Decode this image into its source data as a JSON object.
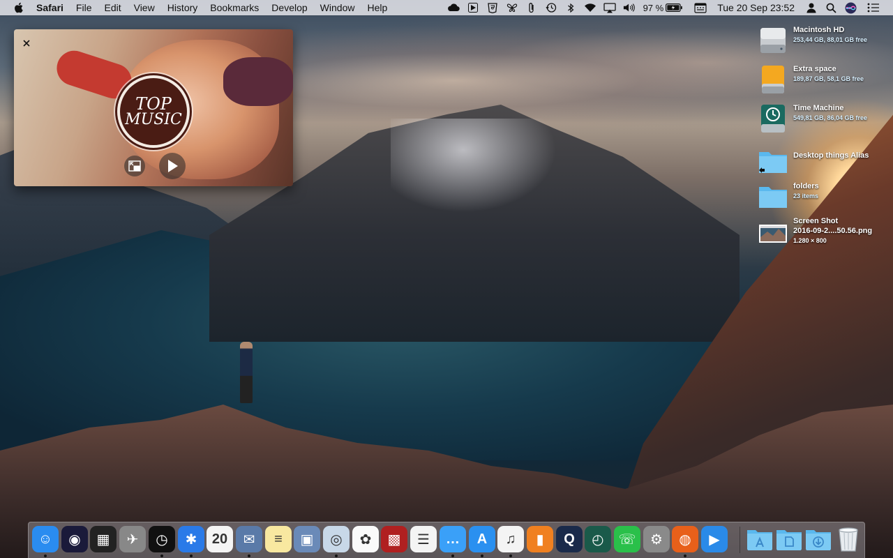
{
  "menubar": {
    "app_name": "Safari",
    "menus": [
      "File",
      "Edit",
      "View",
      "History",
      "Bookmarks",
      "Develop",
      "Window",
      "Help"
    ],
    "status_icons": [
      "cloud-icon",
      "play-triangle-icon",
      "html5-icon",
      "butterfly-icon",
      "paperclip-icon",
      "time-machine-icon",
      "bluetooth-icon",
      "wifi-icon",
      "airplay-icon",
      "volume-icon"
    ],
    "battery_percent": "97 %",
    "datetime": "Tue 20 Sep  23:52"
  },
  "pip": {
    "badge_line1": "TOP",
    "badge_line2": "MUSIC",
    "accent": "#4a1c14"
  },
  "desktop": {
    "items": [
      {
        "name": "Macintosh HD",
        "info": "253,44 GB, 88,01 GB free",
        "icon": "hard-drive-icon"
      },
      {
        "name": "Extra space",
        "info": "189,87 GB, 58,1 GB free",
        "icon": "external-drive-icon"
      },
      {
        "name": "Time Machine",
        "info": "549,81 GB, 86,04 GB free",
        "icon": "time-machine-drive-icon"
      },
      {
        "name": "Desktop things Alias",
        "info": "",
        "icon": "folder-alias-icon"
      },
      {
        "name": "folders",
        "info": "23 items",
        "icon": "folder-icon"
      },
      {
        "name": "Screen Shot",
        "name2": "2016-09-2....50.56.png",
        "info": "1.280 × 800",
        "icon": "screenshot-thumbnail-icon"
      }
    ]
  },
  "dock": {
    "apps": [
      {
        "name": "finder",
        "color": "#2a8cf0",
        "glyph": "☺",
        "running": true
      },
      {
        "name": "siri",
        "color": "#1a1a3a",
        "glyph": "◉",
        "running": false
      },
      {
        "name": "mission-control",
        "color": "#222",
        "glyph": "▦",
        "running": false
      },
      {
        "name": "launchpad",
        "color": "#888",
        "glyph": "✈",
        "running": false
      },
      {
        "name": "dashboard",
        "color": "#111",
        "glyph": "◷",
        "running": true
      },
      {
        "name": "safari",
        "color": "#2a7ae8",
        "glyph": "✱",
        "running": true
      },
      {
        "name": "calendar",
        "color": "#f4f4f4",
        "glyph": "20",
        "running": false
      },
      {
        "name": "mail",
        "color": "#5a7aa8",
        "glyph": "✉",
        "running": true
      },
      {
        "name": "notes",
        "color": "#f8e8a0",
        "glyph": "≡",
        "running": false
      },
      {
        "name": "preview",
        "color": "#6a8ab8",
        "glyph": "▣",
        "running": false
      },
      {
        "name": "image-capture",
        "color": "#c8d8e8",
        "glyph": "◎",
        "running": true
      },
      {
        "name": "photos",
        "color": "#fafafa",
        "glyph": "✿",
        "running": false
      },
      {
        "name": "photo-booth",
        "color": "#b02020",
        "glyph": "▩",
        "running": false
      },
      {
        "name": "reminders",
        "color": "#f4f4f4",
        "glyph": "☰",
        "running": false
      },
      {
        "name": "messages",
        "color": "#3aa0f8",
        "glyph": "…",
        "running": true
      },
      {
        "name": "app-store",
        "color": "#2a90f0",
        "glyph": "A",
        "running": true
      },
      {
        "name": "itunes",
        "color": "#f4f4f4",
        "glyph": "♫",
        "running": true
      },
      {
        "name": "ibooks",
        "color": "#f08020",
        "glyph": "▮",
        "running": false
      },
      {
        "name": "quicktime",
        "color": "#1a2a4a",
        "glyph": "Q",
        "running": false
      },
      {
        "name": "time-machine",
        "color": "#1a5a4a",
        "glyph": "◴",
        "running": false
      },
      {
        "name": "facetime",
        "color": "#2ac04a",
        "glyph": "☏",
        "running": false
      },
      {
        "name": "system-preferences",
        "color": "#8a8a8a",
        "glyph": "⚙",
        "running": false
      },
      {
        "name": "firefox",
        "color": "#e8601a",
        "glyph": "◍",
        "running": true
      },
      {
        "name": "quicktime-player",
        "color": "#2a8ae8",
        "glyph": "▶",
        "running": false
      }
    ],
    "stacks": [
      {
        "name": "applications-folder",
        "glyph": "A"
      },
      {
        "name": "documents-folder",
        "glyph": "▤"
      },
      {
        "name": "downloads-folder",
        "glyph": "⬇"
      }
    ],
    "trash_name": "trash"
  }
}
